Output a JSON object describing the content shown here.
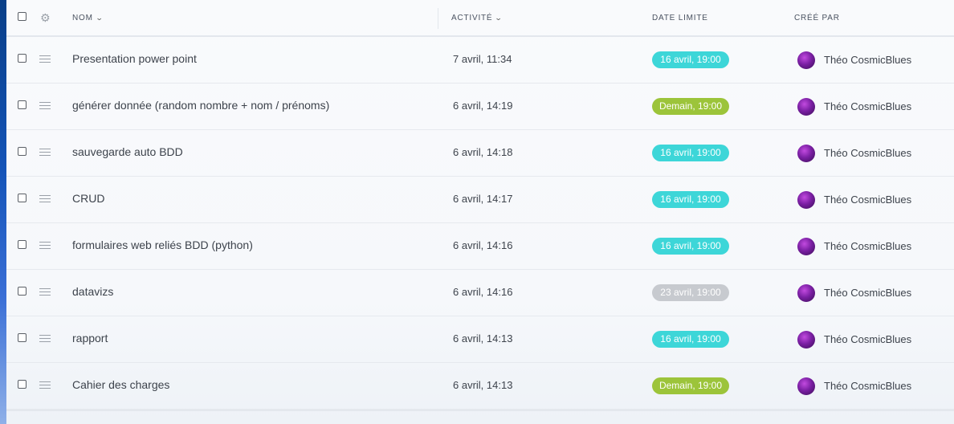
{
  "header": {
    "name": "NOM",
    "activity": "ACTIVITÉ",
    "due_date": "DATE LIMITE",
    "created_by": "CRÉÉ PAR"
  },
  "colors": {
    "teal": "#3dd6d8",
    "green": "#9cc43a",
    "gray": "#c7cacf"
  },
  "rows": [
    {
      "name": "Presentation power point",
      "activity": "7 avril, 11:34",
      "due": "16 avril, 19:00",
      "due_color": "#3dd6d8",
      "creator": "Théo CosmicBlues"
    },
    {
      "name": "générer donnée (random nombre + nom / prénoms)",
      "activity": "6 avril, 14:19",
      "due": "Demain, 19:00",
      "due_color": "#9cc43a",
      "creator": "Théo CosmicBlues"
    },
    {
      "name": "sauvegarde auto BDD",
      "activity": "6 avril, 14:18",
      "due": "16 avril, 19:00",
      "due_color": "#3dd6d8",
      "creator": "Théo CosmicBlues"
    },
    {
      "name": "CRUD",
      "activity": "6 avril, 14:17",
      "due": "16 avril, 19:00",
      "due_color": "#3dd6d8",
      "creator": "Théo CosmicBlues"
    },
    {
      "name": "formulaires web reliés BDD (python)",
      "activity": "6 avril, 14:16",
      "due": "16 avril, 19:00",
      "due_color": "#3dd6d8",
      "creator": "Théo CosmicBlues"
    },
    {
      "name": "datavizs",
      "activity": "6 avril, 14:16",
      "due": "23 avril, 19:00",
      "due_color": "#c7cacf",
      "creator": "Théo CosmicBlues"
    },
    {
      "name": "rapport",
      "activity": "6 avril, 14:13",
      "due": "16 avril, 19:00",
      "due_color": "#3dd6d8",
      "creator": "Théo CosmicBlues"
    },
    {
      "name": "Cahier des charges",
      "activity": "6 avril, 14:13",
      "due": "Demain, 19:00",
      "due_color": "#9cc43a",
      "creator": "Théo CosmicBlues"
    }
  ]
}
